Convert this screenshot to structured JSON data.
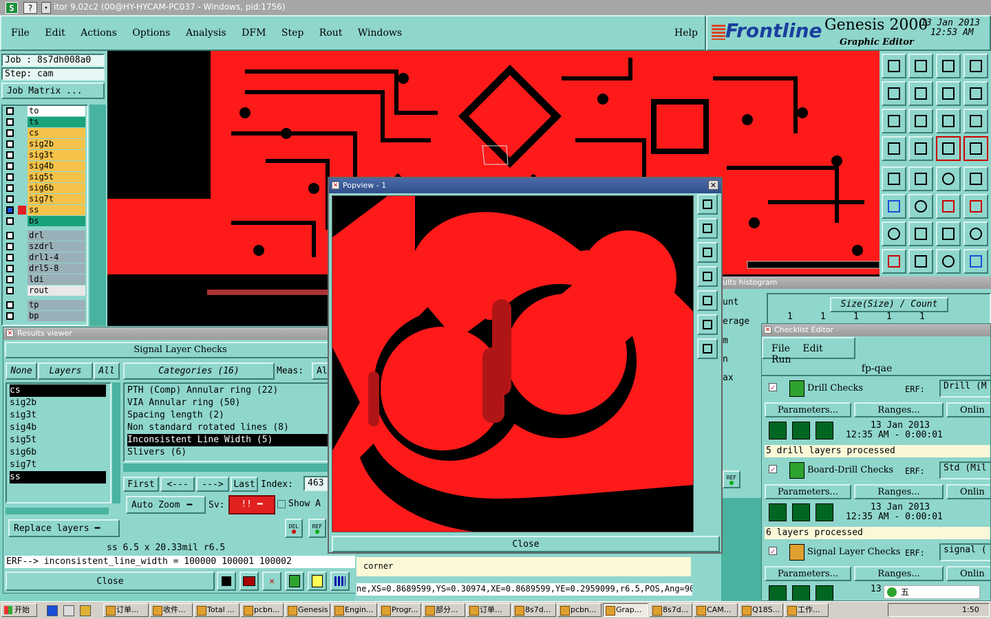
{
  "window": {
    "title": "itor 9.02c2 (00@HY-HYCAM-PC037 - Windows, pid:1756)"
  },
  "menu": {
    "items": [
      "File",
      "Edit",
      "Actions",
      "Options",
      "Analysis",
      "DFM",
      "Step",
      "Rout",
      "Windows"
    ],
    "help": "Help"
  },
  "brand": {
    "logo": "Frontline",
    "product": "Genesis 2000",
    "subtitle": "Graphic Editor",
    "date": "13 Jan 2013",
    "time": "12:53 AM"
  },
  "job": {
    "job_label": "Job : 8s7dh008a0",
    "step_label": "Step: cam",
    "matrix_button": "Job Matrix ..."
  },
  "layers": [
    {
      "name": "to",
      "color": "#ffffff"
    },
    {
      "name": "ts",
      "color": "#1aa27b"
    },
    {
      "name": "cs",
      "color": "#f6c34a"
    },
    {
      "name": "sig2b",
      "color": "#f6c34a"
    },
    {
      "name": "sig3t",
      "color": "#f6c34a"
    },
    {
      "name": "sig4b",
      "color": "#f6c34a"
    },
    {
      "name": "sig5t",
      "color": "#f6c34a"
    },
    {
      "name": "sig6b",
      "color": "#f6c34a"
    },
    {
      "name": "sig7t",
      "color": "#f6c34a"
    },
    {
      "name": "ss",
      "color": "#f6c34a"
    },
    {
      "name": "bs",
      "color": "#1aa27b"
    },
    {
      "name": "drl",
      "color": "#9ab0b8"
    },
    {
      "name": "szdrl",
      "color": "#9ab0b8"
    },
    {
      "name": "drl1-4",
      "color": "#9ab0b8"
    },
    {
      "name": "drl5-8",
      "color": "#9ab0b8"
    },
    {
      "name": "ldi",
      "color": "#9ab0b8"
    },
    {
      "name": "rout",
      "color": "#e8e8e8"
    },
    {
      "name": "tp",
      "color": "#9ab0b8"
    },
    {
      "name": "bp",
      "color": "#9ab0b8"
    }
  ],
  "results_viewer": {
    "title": "Results viewer",
    "header": "Signal Layer Checks",
    "none_btn": "None",
    "layers_btn": "Layers",
    "all_btn": "All",
    "layer_list": [
      "cs",
      "sig2b",
      "sig3t",
      "sig4b",
      "sig5t",
      "sig6b",
      "sig7t",
      "ss"
    ],
    "categories_label": "Categories (16)",
    "meas_label": "Meas:",
    "meas_value": "Al",
    "categories": [
      "PTH (Comp) Annular ring (22)",
      "VIA Annular ring (50)",
      "Spacing length (2)",
      "Non standard rotated lines (8)",
      "Inconsistent Line Width (5)",
      "Slivers (6)"
    ],
    "nav": {
      "first": "First",
      "prev": "<---",
      "next": "--->",
      "last": "Last",
      "index_label": "Index:",
      "index_value": "463"
    },
    "auto_zoom": "Auto Zoom",
    "sv_label": "Sv:",
    "sv_value": "!!",
    "show_label": "Show A",
    "replace_layers": "Replace layers",
    "del_label": "DEL",
    "ref_label": "REF",
    "status": "ss 6.5 x 20.33mil r6.5",
    "erf": "ERF--> inconsistent_line_width = 100000 100001 100002",
    "close": "Close"
  },
  "popview": {
    "title": "Popview - 1",
    "close": "Close"
  },
  "histogram": {
    "title": "ults histogram",
    "stats": [
      "unt",
      "erage",
      "m",
      "n",
      "ax"
    ],
    "header": "Size(Size) / Count",
    "counts": [
      "1",
      "1",
      "1",
      "1",
      "1"
    ]
  },
  "checklist": {
    "title": "Checklist Editor",
    "menu": [
      "File",
      "Edit",
      "Run"
    ],
    "name": "fp-qae",
    "checks": [
      {
        "name": "Drill Checks",
        "erf_label": "ERF:",
        "erf_value": "Drill (M",
        "params": "Parameters...",
        "ranges": "Ranges...",
        "online": "Onlin",
        "date": "13 Jan 2013",
        "time": "12:35 AM - 0:00:01",
        "status": "5 drill layers processed"
      },
      {
        "name": "Board-Drill Checks",
        "erf_label": "ERF:",
        "erf_value": "Std (Mil",
        "params": "Parameters...",
        "ranges": "Ranges...",
        "online": "Onlin",
        "date": "13 Jan 2013",
        "time": "12:35 AM - 0:00:01",
        "status": "6 layers processed"
      },
      {
        "name": "Signal Layer Checks",
        "erf_label": "ERF:",
        "erf_value": "signal (",
        "params": "Parameters...",
        "ranges": "Ranges...",
        "online": "Onlin",
        "date": "13",
        "time": "",
        "status": ""
      }
    ]
  },
  "bottom": {
    "corner": "corner",
    "coords": "ne,XS=0.8689599,YS=0.30974,XE=0.8689599,YE=0.2959099,r6.5,POS,Ang=90",
    "ref_label": "REF"
  },
  "taskbar": {
    "start": "开始",
    "items": [
      "订单...",
      "收件...",
      "Total ...",
      "pcbn...",
      "Genesis",
      "Engin...",
      "Progr...",
      "部分...",
      "订单...",
      "8s7d...",
      "pcbn...",
      "Grap...",
      "8s7d...",
      "CAM...",
      "Q18S...",
      "工作..."
    ],
    "ime": "五",
    "clock": "1:50"
  }
}
